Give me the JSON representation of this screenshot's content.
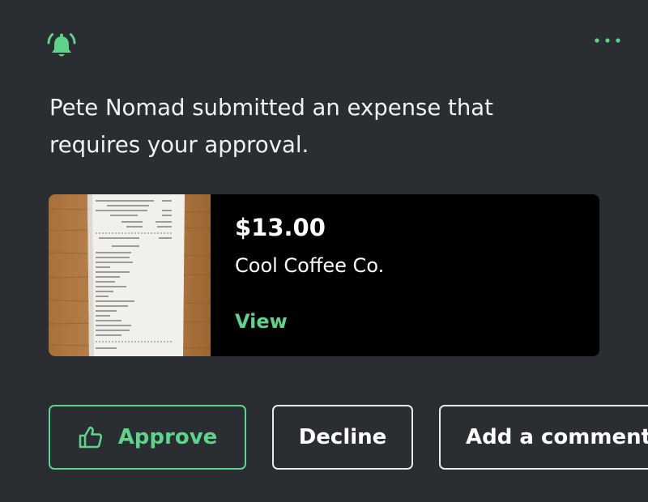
{
  "notification": {
    "message": "Pete Nomad submitted an expense that requires your approval."
  },
  "expense": {
    "amount": "$13.00",
    "merchant": "Cool Coffee Co.",
    "view_label": "View"
  },
  "actions": {
    "approve_label": "Approve",
    "decline_label": "Decline",
    "comment_label": "Add a comment"
  },
  "icons": {
    "bell": "bell-ringing-icon",
    "more": "more-horizontal-icon",
    "approve": "thumbs-up-icon"
  },
  "colors": {
    "background": "#2a2d32",
    "accent": "#5ed38a",
    "card": "#000000",
    "text": "#ffffff"
  }
}
